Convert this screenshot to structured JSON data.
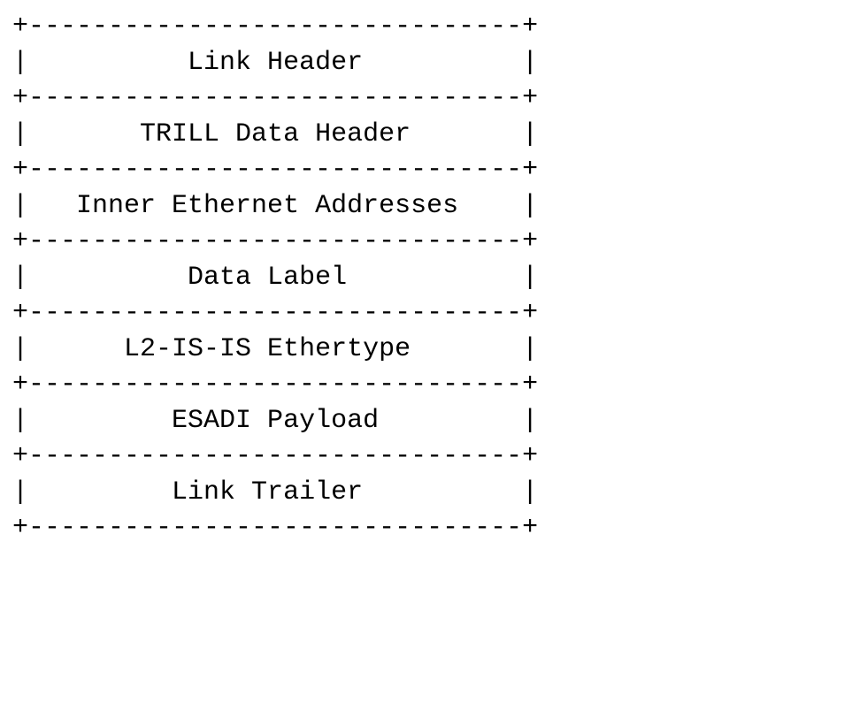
{
  "diagram": {
    "type": "packet-layout",
    "border_char": "-",
    "corner_char": "+",
    "side_char": "|",
    "inner_width_chars": 31,
    "rows": [
      {
        "label": "Link Header"
      },
      {
        "label": "TRILL Data Header"
      },
      {
        "label": "Inner Ethernet Addresses"
      },
      {
        "label": "Data Label"
      },
      {
        "label": "L2-IS-IS Ethertype"
      },
      {
        "label": "ESADI Payload"
      },
      {
        "label": "Link Trailer"
      }
    ]
  }
}
